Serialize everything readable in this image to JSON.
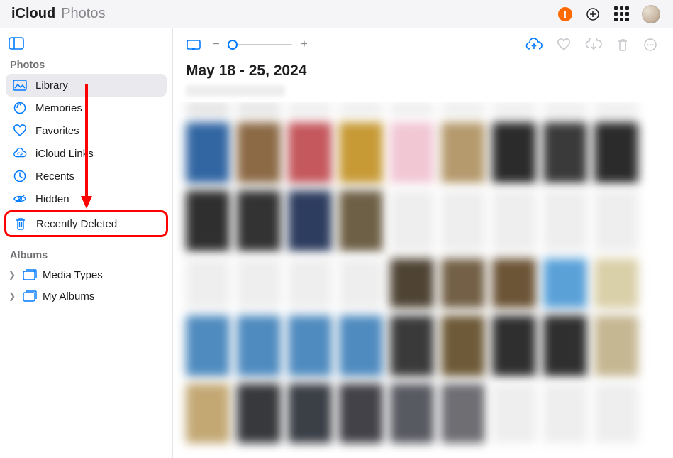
{
  "header": {
    "brand_primary": "iCloud",
    "brand_secondary": "Photos",
    "alert_symbol": "!"
  },
  "sidebar": {
    "sections": {
      "photos_label": "Photos",
      "albums_label": "Albums"
    },
    "items": {
      "library": "Library",
      "memories": "Memories",
      "favorites": "Favorites",
      "icloud_links": "iCloud Links",
      "recents": "Recents",
      "hidden": "Hidden",
      "recently_deleted": "Recently Deleted"
    },
    "albums": {
      "media_types": "Media Types",
      "my_albums": "My Albums"
    }
  },
  "content": {
    "date_range": "May 18 - 25, 2024"
  },
  "thumbs": {
    "row0": [
      "#e3e3e3",
      "#e5e5e5",
      "#eee",
      "#eee",
      "#eee",
      "#eee",
      "#eee",
      "#eee",
      "#eee"
    ],
    "row1": [
      "#3266a3",
      "#8c6a46",
      "#c4585d",
      "#c79a36",
      "#f1c7d4",
      "#b59a6d",
      "#2b2b2b",
      "#3a3a3a",
      "#2b2b2b"
    ],
    "row2": [
      "#2f2f2f",
      "#333333",
      "#2d3d5f",
      "#6e6046",
      "#eeeeee",
      "#eeeeee",
      "#eeeeee",
      "#eeeeee",
      "#eeeeee"
    ],
    "row3": [
      "#eeeeee",
      "#eeeeee",
      "#eeeeee",
      "#eeeeee",
      "#4f4434",
      "#736046",
      "#6c5436",
      "#5aa1d8",
      "#d9cfa8"
    ],
    "row4": [
      "#4f8bbf",
      "#4f8bbf",
      "#4f8bbf",
      "#4f8bbf",
      "#3a3a3a",
      "#6e5a38",
      "#2f2f2f",
      "#2f2f2f",
      "#c5b792"
    ],
    "row5": [
      "#c3a874",
      "#37393c",
      "#3b3f46",
      "#424248",
      "#585a61",
      "#6e6e73",
      "#eeeeee",
      "#eeeeee",
      "#eeeeee"
    ]
  }
}
